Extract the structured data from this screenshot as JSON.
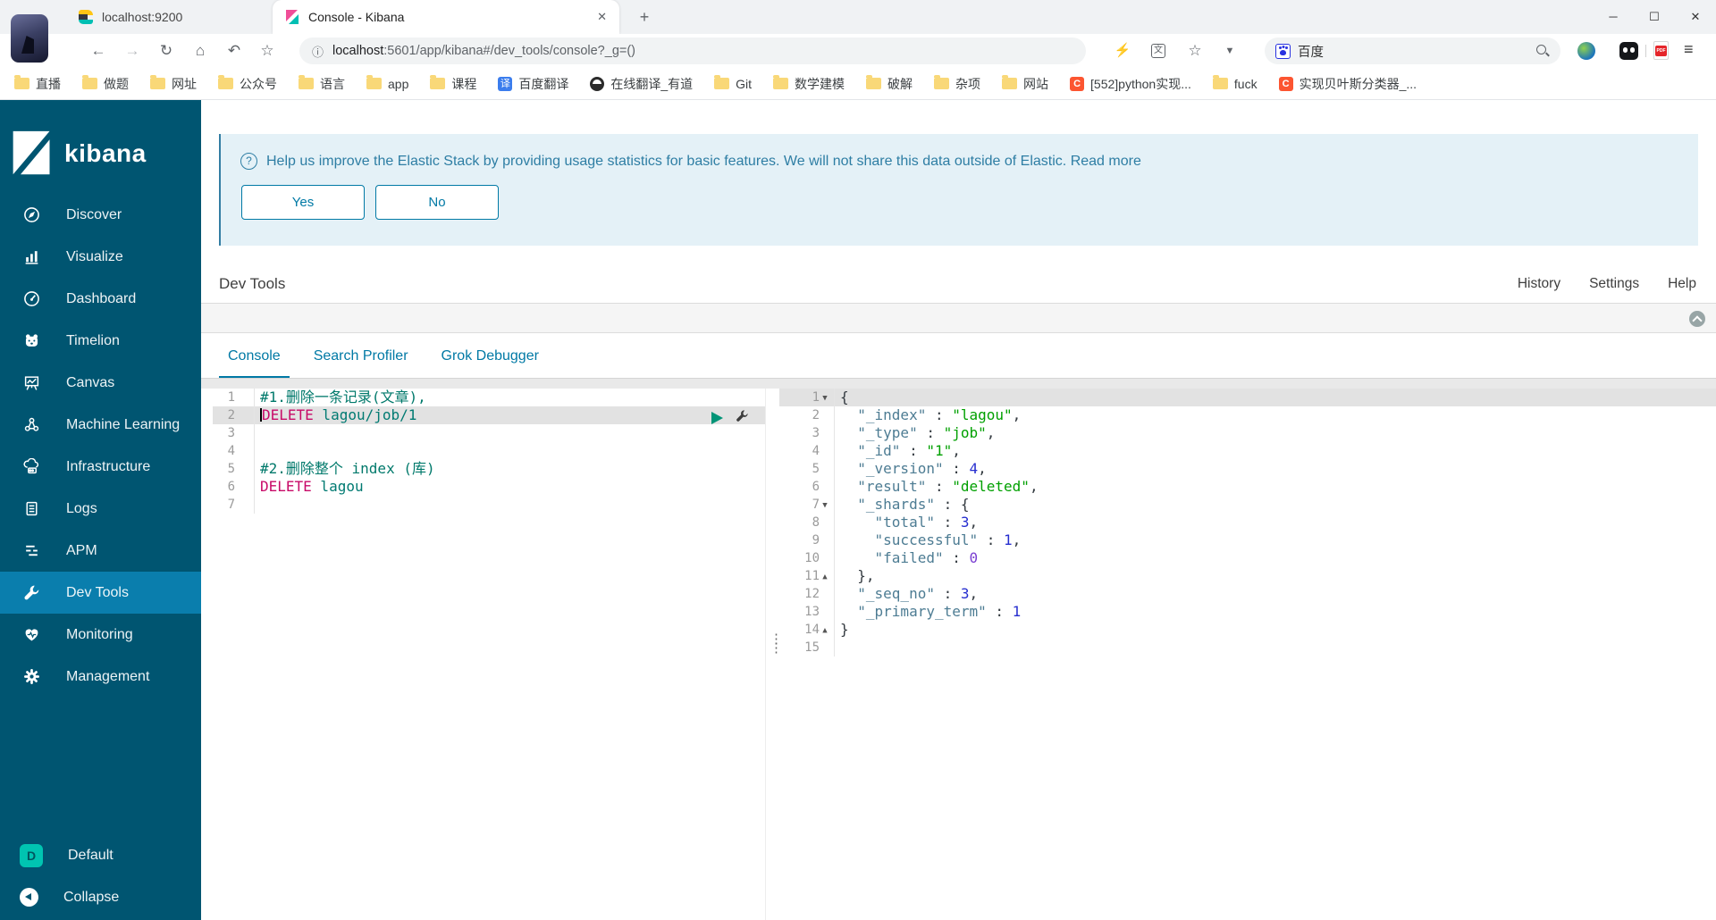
{
  "colors": {
    "accent": "#0079a5",
    "sidebar_bg": "#005571",
    "sidebar_active": "#0a7ead",
    "banner_bg": "#e4f1f7",
    "banner_text": "#2e7ea4",
    "token_comment": "#00796b",
    "token_method": "#c80a68",
    "token_url": "#007a72",
    "json_key": "#4d7c93",
    "json_string": "#00a000",
    "json_number": "#262ecf",
    "play_button": "#019477",
    "space_badge": "#00c4b1"
  },
  "browser": {
    "tabs": [
      {
        "title": "localhost:9200",
        "icon": "elasticsearch-icon",
        "active": false
      },
      {
        "title": "Console - Kibana",
        "icon": "kibana-icon",
        "active": true
      }
    ],
    "address": {
      "host": "localhost",
      "rest": ":5601/app/kibana#/dev_tools/console?_g=()"
    },
    "search": {
      "label": "百度"
    },
    "bookmarks": [
      {
        "label": "直播",
        "icon": "folder"
      },
      {
        "label": "做题",
        "icon": "folder"
      },
      {
        "label": "网址",
        "icon": "folder"
      },
      {
        "label": "公众号",
        "icon": "folder"
      },
      {
        "label": "语言",
        "icon": "folder"
      },
      {
        "label": "app",
        "icon": "folder"
      },
      {
        "label": "课程",
        "icon": "folder"
      },
      {
        "label": "百度翻译",
        "icon": "translate"
      },
      {
        "label": "在线翻译_有道",
        "icon": "youdao"
      },
      {
        "label": "Git",
        "icon": "folder"
      },
      {
        "label": "数学建模",
        "icon": "folder"
      },
      {
        "label": "破解",
        "icon": "folder"
      },
      {
        "label": "杂项",
        "icon": "folder"
      },
      {
        "label": "网站",
        "icon": "folder"
      },
      {
        "label": "[552]python实现...",
        "icon": "csdn"
      },
      {
        "label": "fuck",
        "icon": "folder"
      },
      {
        "label": "实现贝叶斯分类器_...",
        "icon": "csdn"
      }
    ]
  },
  "sidebar": {
    "logo_text": "kibana",
    "items": [
      {
        "label": "Discover",
        "icon": "discover"
      },
      {
        "label": "Visualize",
        "icon": "visualize"
      },
      {
        "label": "Dashboard",
        "icon": "dashboard"
      },
      {
        "label": "Timelion",
        "icon": "timelion"
      },
      {
        "label": "Canvas",
        "icon": "canvas"
      },
      {
        "label": "Machine Learning",
        "icon": "ml"
      },
      {
        "label": "Infrastructure",
        "icon": "infrastructure"
      },
      {
        "label": "Logs",
        "icon": "logs"
      },
      {
        "label": "APM",
        "icon": "apm"
      },
      {
        "label": "Dev Tools",
        "icon": "wrench",
        "active": true
      },
      {
        "label": "Monitoring",
        "icon": "monitoring"
      },
      {
        "label": "Management",
        "icon": "gear"
      }
    ],
    "space": {
      "label": "Default",
      "letter": "D"
    },
    "collapse_label": "Collapse"
  },
  "banner": {
    "message": "Help us improve the Elastic Stack by providing usage statistics for basic features. We will not share this data outside of Elastic.",
    "link_label": "Read more",
    "yes_label": "Yes",
    "no_label": "No"
  },
  "devtools": {
    "title": "Dev Tools",
    "menu": [
      "History",
      "Settings",
      "Help"
    ],
    "tabs": [
      {
        "label": "Console",
        "active": true
      },
      {
        "label": "Search Profiler",
        "active": false
      },
      {
        "label": "Grok Debugger",
        "active": false
      }
    ]
  },
  "console": {
    "request_lines": [
      {
        "tokens": [
          [
            "comment",
            "#1.删除一条记录(文章),"
          ]
        ]
      },
      {
        "active": true,
        "cursor": true,
        "actions": true,
        "tokens": [
          [
            "method",
            "DELETE"
          ],
          [
            "url",
            " lagou/job/1"
          ]
        ]
      },
      {
        "tokens": []
      },
      {
        "tokens": []
      },
      {
        "tokens": [
          [
            "comment",
            "#2.删除整个 index (库)"
          ]
        ]
      },
      {
        "tokens": [
          [
            "method",
            "DELETE"
          ],
          [
            "url",
            " lagou"
          ]
        ]
      },
      {
        "tokens": []
      }
    ],
    "response_lines": [
      {
        "fold": "down",
        "active": true,
        "tokens": [
          [
            "p",
            "{"
          ]
        ]
      },
      {
        "tokens": [
          [
            "p",
            "  "
          ],
          [
            "k",
            "\"_index\""
          ],
          [
            "p",
            " : "
          ],
          [
            "s",
            "\"lagou\""
          ],
          [
            "p",
            ","
          ]
        ]
      },
      {
        "tokens": [
          [
            "p",
            "  "
          ],
          [
            "k",
            "\"_type\""
          ],
          [
            "p",
            " : "
          ],
          [
            "s",
            "\"job\""
          ],
          [
            "p",
            ","
          ]
        ]
      },
      {
        "tokens": [
          [
            "p",
            "  "
          ],
          [
            "k",
            "\"_id\""
          ],
          [
            "p",
            " : "
          ],
          [
            "s",
            "\"1\""
          ],
          [
            "p",
            ","
          ]
        ]
      },
      {
        "tokens": [
          [
            "p",
            "  "
          ],
          [
            "k",
            "\"_version\""
          ],
          [
            "p",
            " : "
          ],
          [
            "n",
            "4"
          ],
          [
            "p",
            ","
          ]
        ]
      },
      {
        "tokens": [
          [
            "p",
            "  "
          ],
          [
            "k",
            "\"result\""
          ],
          [
            "p",
            " : "
          ],
          [
            "s",
            "\"deleted\""
          ],
          [
            "p",
            ","
          ]
        ]
      },
      {
        "fold": "down",
        "tokens": [
          [
            "p",
            "  "
          ],
          [
            "k",
            "\"_shards\""
          ],
          [
            "p",
            " : {"
          ]
        ]
      },
      {
        "tokens": [
          [
            "p",
            "    "
          ],
          [
            "k",
            "\"total\""
          ],
          [
            "p",
            " : "
          ],
          [
            "n",
            "3"
          ],
          [
            "p",
            ","
          ]
        ]
      },
      {
        "tokens": [
          [
            "p",
            "    "
          ],
          [
            "k",
            "\"successful\""
          ],
          [
            "p",
            " : "
          ],
          [
            "n",
            "1"
          ],
          [
            "p",
            ","
          ]
        ]
      },
      {
        "tokens": [
          [
            "p",
            "    "
          ],
          [
            "k",
            "\"failed\""
          ],
          [
            "p",
            " : "
          ],
          [
            "n0",
            "0"
          ]
        ]
      },
      {
        "fold": "up",
        "tokens": [
          [
            "p",
            "  },"
          ]
        ]
      },
      {
        "tokens": [
          [
            "p",
            "  "
          ],
          [
            "k",
            "\"_seq_no\""
          ],
          [
            "p",
            " : "
          ],
          [
            "n",
            "3"
          ],
          [
            "p",
            ","
          ]
        ]
      },
      {
        "tokens": [
          [
            "p",
            "  "
          ],
          [
            "k",
            "\"_primary_term\""
          ],
          [
            "p",
            " : "
          ],
          [
            "n",
            "1"
          ]
        ]
      },
      {
        "fold": "up",
        "tokens": [
          [
            "p",
            "}"
          ]
        ]
      },
      {
        "tokens": []
      }
    ]
  }
}
